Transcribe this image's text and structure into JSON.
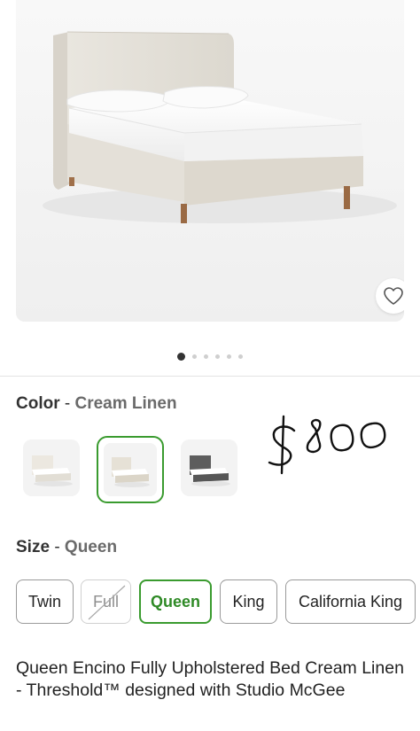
{
  "colors": {
    "accent": "#3a9b2f",
    "heading": "#333333",
    "muted": "#6a6a6a"
  },
  "gallery": {
    "image_alt": "Encino fully upholstered bed in cream linen",
    "dot_count": 6,
    "active_index": 0,
    "favorite_icon": "heart-outline-icon"
  },
  "color_option": {
    "label": "Color",
    "separator": "-",
    "selected": "Cream Linen",
    "swatches": [
      {
        "name": "Cream Linen (light)",
        "selected": false
      },
      {
        "name": "Cream Linen",
        "selected": true
      },
      {
        "name": "Gray",
        "selected": false
      }
    ]
  },
  "annotation": {
    "handwritten_price": "$800"
  },
  "size_option": {
    "label": "Size",
    "separator": "-",
    "selected": "Queen",
    "sizes": [
      {
        "label": "Twin",
        "state": "available"
      },
      {
        "label": "Full",
        "state": "unavailable"
      },
      {
        "label": "Queen",
        "state": "selected"
      },
      {
        "label": "King",
        "state": "available"
      },
      {
        "label": "California King",
        "state": "available"
      }
    ]
  },
  "product": {
    "title": "Queen Encino Fully Upholstered Bed Cream Linen - Threshold™ designed with Studio McGee"
  }
}
